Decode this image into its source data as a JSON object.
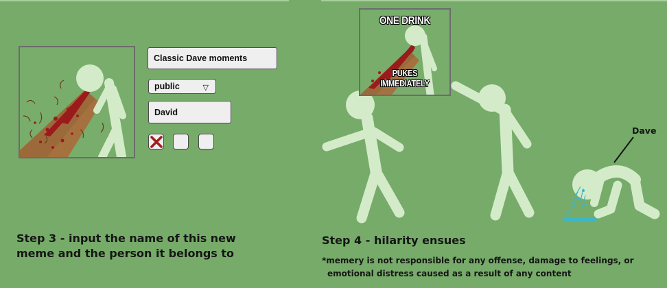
{
  "form": {
    "meme_name": "Classic Dave moments",
    "visibility": "public",
    "person_name": "David",
    "checkboxes": [
      {
        "state": "checked",
        "icon": "x-mark-icon"
      },
      {
        "state": "unchecked"
      },
      {
        "state": "unchecked"
      }
    ]
  },
  "step3": {
    "line1": "Step 3 - input the name of this new",
    "line2": "meme and the person it belongs to"
  },
  "step4": {
    "title": "Step 4 - hilarity ensues"
  },
  "disclaimer": {
    "line1": "*memery is not responsible for any offense, damage to feelings, or",
    "line2": "emotional distress caused as a result of any content"
  },
  "meme": {
    "top_text": "ONE DRINK",
    "bottom_text": "PUKES IMMEDIATELY"
  },
  "scene": {
    "label": "Dave"
  },
  "colors": {
    "background": "#76ab69",
    "stickfigure": "#d4ebc9",
    "blood": "#9a1b1b",
    "puke": "#3fb6c8",
    "check_x": "#a11d1d"
  }
}
